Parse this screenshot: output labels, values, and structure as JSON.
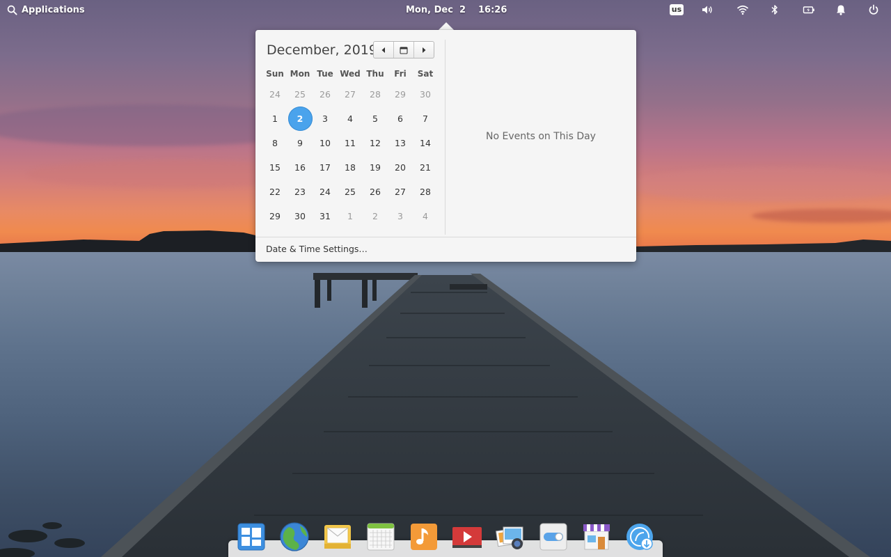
{
  "panel": {
    "applications_label": "Applications",
    "date": "Mon, Dec  2",
    "time": "16:26",
    "keyboard_layout": "us",
    "indicators": [
      "sound-icon",
      "wifi-icon",
      "bluetooth-icon",
      "battery-icon",
      "notifications-icon",
      "power-icon"
    ]
  },
  "calendar": {
    "month_title": "December, 2019",
    "weekdays": [
      "Sun",
      "Mon",
      "Tue",
      "Wed",
      "Thu",
      "Fri",
      "Sat"
    ],
    "weeks": [
      [
        "24",
        "25",
        "26",
        "27",
        "28",
        "29",
        "30"
      ],
      [
        "1",
        "2",
        "3",
        "4",
        "5",
        "6",
        "7"
      ],
      [
        "8",
        "9",
        "10",
        "11",
        "12",
        "13",
        "14"
      ],
      [
        "15",
        "16",
        "17",
        "18",
        "19",
        "20",
        "21"
      ],
      [
        "22",
        "23",
        "24",
        "25",
        "26",
        "27",
        "28"
      ],
      [
        "29",
        "30",
        "31",
        "1",
        "2",
        "3",
        "4"
      ]
    ],
    "selected_day": "2",
    "selected_color": "#4aa3ec",
    "no_events_text": "No Events on This Day",
    "settings_link": "Date & Time Settings…"
  },
  "dock": {
    "apps": [
      "multitasking-view-icon",
      "web-browser-icon",
      "mail-icon",
      "calendar-app-icon",
      "music-icon",
      "videos-icon",
      "photos-icon",
      "system-settings-icon",
      "app-center-icon",
      "installer-icon"
    ]
  }
}
